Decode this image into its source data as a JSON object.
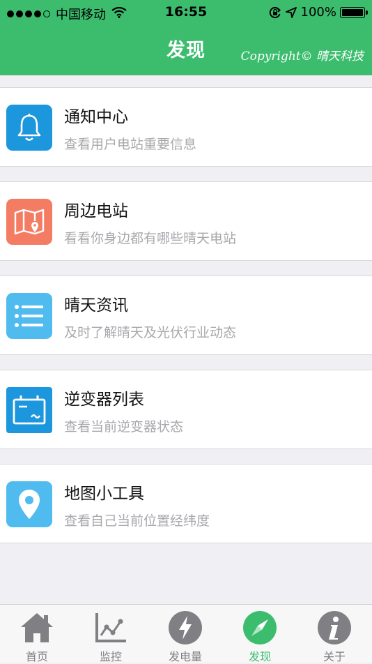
{
  "status_bar": {
    "carrier": "中国移动",
    "time": "16:55",
    "battery": "100%",
    "battery_level": 1.0
  },
  "header": {
    "title": "发现",
    "copyright": "Copyright© 晴天科技",
    "background_color": "#3cbd6e"
  },
  "menu": [
    {
      "title": "通知中心",
      "subtitle": "查看用户电站重要信息",
      "icon": "bell-icon",
      "color": "#1c96dc"
    },
    {
      "title": "周边电站",
      "subtitle": "看看你身边都有哪些晴天电站",
      "icon": "map-pin-icon",
      "color": "#f47c63"
    },
    {
      "title": "晴天资讯",
      "subtitle": "及时了解晴天及光伏行业动态",
      "icon": "list-icon",
      "color": "#4fbbef"
    },
    {
      "title": "逆变器列表",
      "subtitle": "查看当前逆变器状态",
      "icon": "inverter-icon",
      "color": "#1c96dc"
    },
    {
      "title": "地图小工具",
      "subtitle": "查看自己当前位置经纬度",
      "icon": "location-icon",
      "color": "#4fbbef"
    }
  ],
  "tabs": [
    {
      "label": "首页",
      "icon": "home-icon"
    },
    {
      "label": "监控",
      "icon": "chart-icon"
    },
    {
      "label": "发电量",
      "icon": "lightning-icon"
    },
    {
      "label": "发现",
      "icon": "compass-icon",
      "active": true
    },
    {
      "label": "关于",
      "icon": "info-icon"
    }
  ],
  "colors": {
    "active_tab": "#3cbd6e",
    "inactive_tab": "#7f7f84"
  }
}
